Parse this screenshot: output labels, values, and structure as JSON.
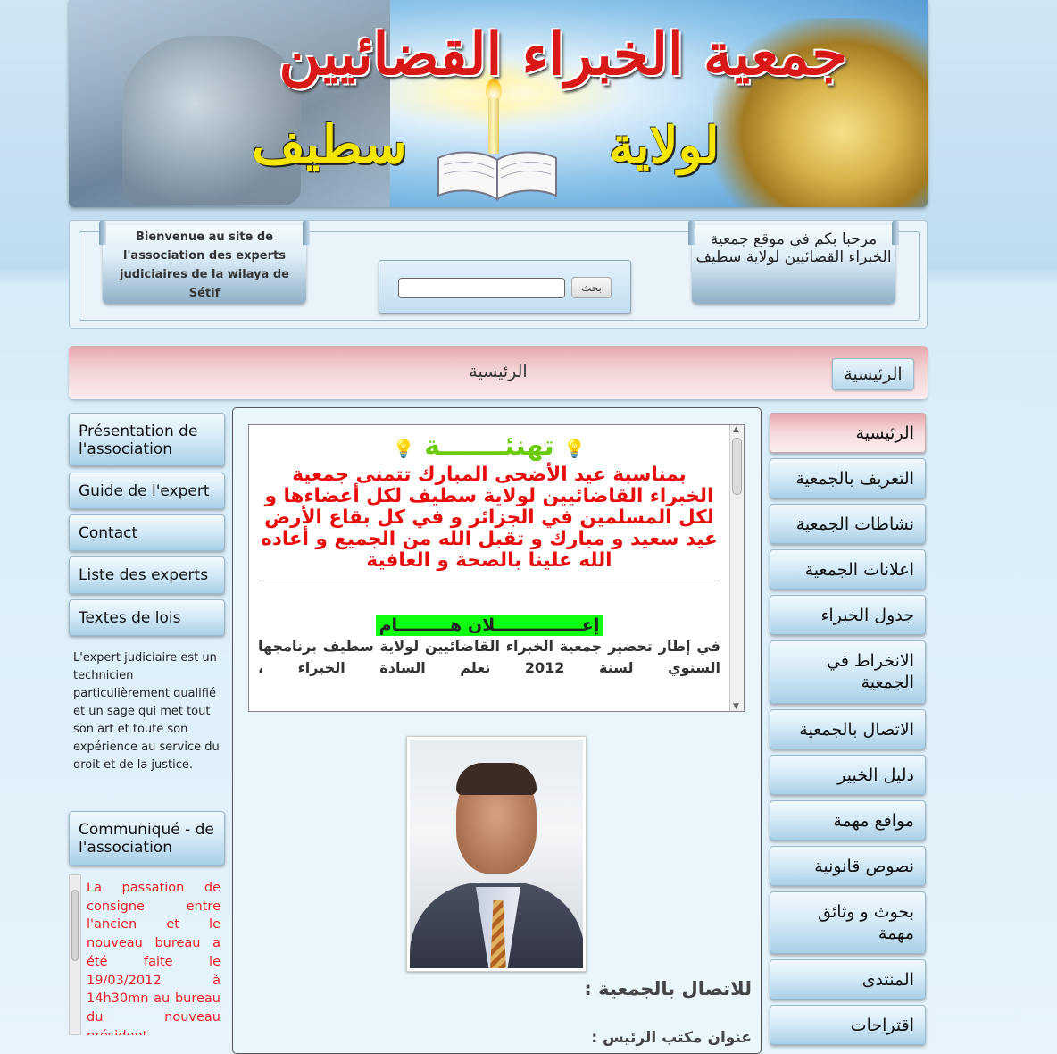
{
  "banner": {
    "title": "جمعية الخبراء القضائيين",
    "wilaya": "لولاية",
    "city": "سطيف"
  },
  "welcome": {
    "left_ribbon": "Bienvenue au site de l'association des experts judiciaires de la wilaya de Sétif",
    "right_ribbon": "مرحبا بكم في موقع جمعية الخبراء القضائيين لولاية سطيف",
    "search_value": "",
    "search_button": "بحث"
  },
  "breadcrumb": {
    "current": "الرئيسية",
    "home_button": "الرئيسية"
  },
  "left_menu": {
    "items": [
      {
        "label": "Présentation de l'association"
      },
      {
        "label": "Guide de l'expert"
      },
      {
        "label": "Contact"
      },
      {
        "label": "Liste des experts"
      },
      {
        "label": "Textes de lois"
      }
    ],
    "description": "L'expert judiciaire est un technicien particulièrement qualifié et un sage qui met tout son art et toute son expérience au service du droit et de la justice.",
    "communique_title": "Communiqué - de l'association",
    "communique_text": "La passation de consigne entre l'ancien et le nouveau bureau a été faite le 19/03/2012 à 14h30mn au bureau du nouveau président"
  },
  "announcement": {
    "heading": "تهنئـــــــة",
    "greeting": "بمناسبة عيد الأضحى المبارك تتمنى جمعية الخبراء القاضائيين لولاية سطيف لكل أعضاءها و لكل المسلمين في الجزائر و في كل بقاع الأرض عيد سعيد و مبارك و تقبل الله من الجميع و أعاده الله علينا بالصحة و العافية",
    "notice_title": "إعـــــــــــــــلان هـــــــــام",
    "notice_body": "في إطار تحضير جمعية الخبراء القاضائيين لولاية سطيف برنامجها السنوي لسنة 2012 نعلم السادة الخبراء ،"
  },
  "contact": {
    "heading": "للاتصال بالجمعية :",
    "office": "عنوان مكتب الرئيس :"
  },
  "right_menu": {
    "items": [
      {
        "label": "الرئيسية"
      },
      {
        "label": "التعريف بالجمعية"
      },
      {
        "label": "نشاطات الجمعية"
      },
      {
        "label": "اعلانات الجمعية"
      },
      {
        "label": "جدول الخبراء"
      },
      {
        "label": "الانخراط في الجمعية"
      },
      {
        "label": "الاتصال بالجمعية"
      },
      {
        "label": "دليل الخبير"
      },
      {
        "label": "مواقع مهمة"
      },
      {
        "label": "نصوص قانونية"
      },
      {
        "label": "بحوث و وثائق مهمة"
      },
      {
        "label": "المنتدى"
      },
      {
        "label": "اقتراحات"
      }
    ]
  },
  "colors": {
    "accent_red": "#e80c0c",
    "heading_green": "#6bcb0c",
    "highlight_green": "#10ff10",
    "active_menu_pink": "#e6a8ac",
    "menu_blue": "#a9d0e8"
  }
}
